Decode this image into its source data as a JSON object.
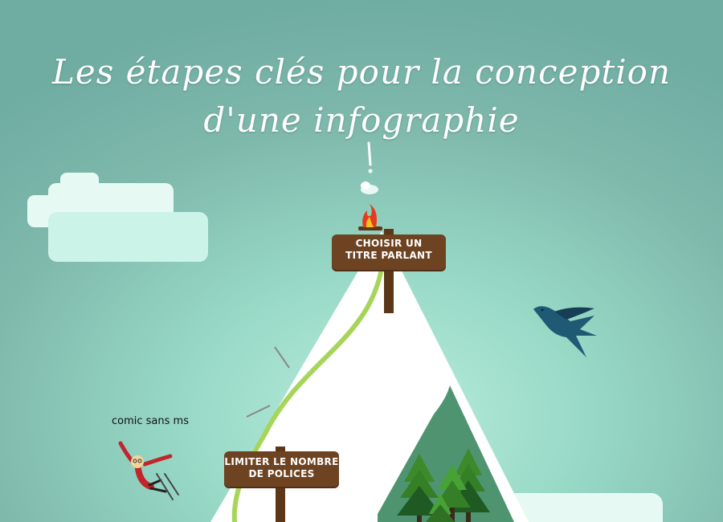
{
  "title": {
    "line1": "Les étapes clés pour la conception",
    "line2": "d'une infographie"
  },
  "signs": {
    "top": {
      "line1": "CHOISIR UN",
      "line2": "TITRE PARLANT"
    },
    "bottom": {
      "line1": "LIMITER LE NOMBRE",
      "line2": "DE POLICES"
    }
  },
  "skier_label": "comic sans ms",
  "colors": {
    "background": "#7fb9ac",
    "sign": "#6e4322",
    "trail": "#a6d55a",
    "mountain_snow": "#ffffff",
    "mountain_rock": "#4f9470",
    "bird": "#1f5a75",
    "skier_suit": "#c0262c"
  }
}
